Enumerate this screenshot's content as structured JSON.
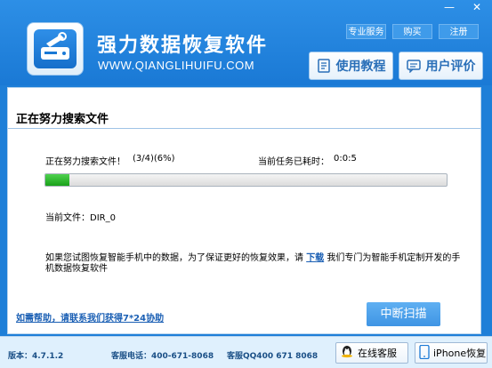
{
  "header": {
    "title": "强力数据恢复软件",
    "subtitle": "WWW.QIANGLIHUIFU.COM",
    "links": [
      "专业服务",
      "购买",
      "注册"
    ],
    "window_controls": {
      "minimize": "—",
      "close": "✕"
    },
    "tutorial_button": "使用教程",
    "review_button": "用户评价"
  },
  "main": {
    "section_title": "正在努力搜索文件",
    "progress_label": "正在努力搜索文件！",
    "progress_count": "(3/4)(6%)",
    "progress_fraction": 0.06,
    "elapsed_label": "当前任务已耗时：",
    "elapsed_value": "0:0:5",
    "current_file": "当前文件：DIR_0",
    "note_before": "如果您试图恢复智能手机中的数据，为了保证更好的恢复效果，请 ",
    "note_link": "下载",
    "note_after": " 我们专门为智能手机定制开发的手机数据恢复软件",
    "help_link": "如需帮助，请联系我们获得7*24协助",
    "stop_button": "中断扫描"
  },
  "footer": {
    "version": "版本：4.7.1.2",
    "phone": "客服电话：400-671-8068",
    "qq": "客服QQ400 671 8068",
    "online_service": "在线客服",
    "iphone_recovery": "iPhone恢复"
  },
  "colors": {
    "accent": "#1e7fd8",
    "progress": "#2bb52b",
    "link": "#1a5fb4"
  }
}
